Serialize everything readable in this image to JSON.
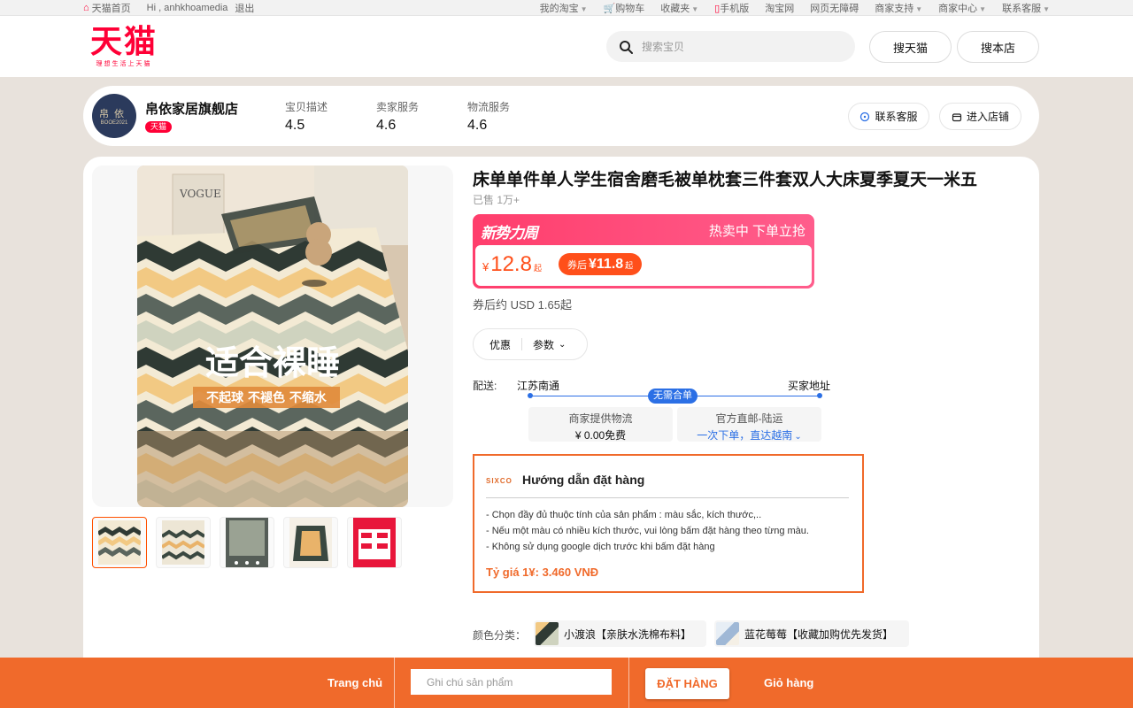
{
  "topbar": {
    "home": "天猫首页",
    "greeting": "Hi , anhkhoamedia",
    "logout": "退出",
    "links": [
      {
        "label": "我的淘宝",
        "caret": true
      },
      {
        "label": "购物车",
        "icon": "cart-icon",
        "red": true
      },
      {
        "label": "收藏夹",
        "caret": true
      },
      {
        "label": "手机版",
        "icon": "phone-icon",
        "red": true
      },
      {
        "label": "淘宝网"
      },
      {
        "label": "网页无障碍"
      },
      {
        "label": "商家支持",
        "caret": true
      },
      {
        "label": "商家中心",
        "caret": true
      },
      {
        "label": "联系客服",
        "caret": true
      }
    ]
  },
  "header": {
    "logo": "天猫",
    "logo_sub": "理想生活上天猫",
    "search_placeholder": "搜索宝贝",
    "search_tmall": "搜天猫",
    "search_store": "搜本店"
  },
  "shop": {
    "avatar_top": "帛依",
    "avatar_bottom": "BOOE2021",
    "name": "帛依家居旗舰店",
    "badge": "天猫",
    "scores": [
      {
        "label": "宝贝描述",
        "value": "4.5"
      },
      {
        "label": "卖家服务",
        "value": "4.6"
      },
      {
        "label": "物流服务",
        "value": "4.6"
      }
    ],
    "contact": "联系客服",
    "enter": "进入店铺"
  },
  "product": {
    "title": "床单单件单人学生宿舍磨毛被单枕套三件套双人大床夏季夏天一米五",
    "sold": "已售 1万+",
    "promo_tag": "新势力周",
    "promo_hot": "热卖中 下单立抢",
    "price_currency": "¥",
    "price": "12.8",
    "price_suffix": "起",
    "coupon_label": "券后",
    "coupon_amount": "¥11.8",
    "coupon_suffix": "起",
    "usd": "券后约 USD 1.65起",
    "tab_discount": "优惠",
    "tab_params": "参数",
    "image_text_main": "适合裸睡",
    "image_text_sub": "不起球 不褪色 不缩水",
    "image_brand": "VOGUE"
  },
  "shipping": {
    "label": "配送:",
    "from": "江苏南通",
    "to": "买家地址",
    "badge": "无需合单",
    "box1_title": "商家提供物流",
    "box1_sub": "¥ 0.00免费",
    "box2_title": "官方直邮-陆运",
    "box2_sub": "一次下单，直达越南"
  },
  "guide": {
    "logo": "SIXCO",
    "title": "Hướng dẫn đặt hàng",
    "lines": [
      "- Chọn đầy đủ thuộc tính của sản phẩm : màu sắc, kích thước,..",
      "- Nếu một màu có nhiều kích thước, vui lòng bấm đặt hàng theo từng màu.",
      "- Không sử dụng google dịch trước khi bấm đặt hàng"
    ],
    "rate": "Tỷ giá 1¥: 3.460 VNĐ"
  },
  "colors": {
    "label": "颜色分类：",
    "options": [
      "小渡浪【亲肤水洗棉布料】",
      "蓝花莓莓【收藏加购优先发货】"
    ]
  },
  "bottom": {
    "home": "Trang chủ",
    "note_placeholder": "Ghi chú sản phẩm",
    "order": "ĐẶT HÀNG",
    "cart": "Giỏ hàng"
  },
  "colors_theme": {
    "tmall_red": "#ff0036",
    "accent_orange": "#f06a2b",
    "promo_pink": "#ff3e6c",
    "shipping_blue": "#2b6fe5"
  }
}
